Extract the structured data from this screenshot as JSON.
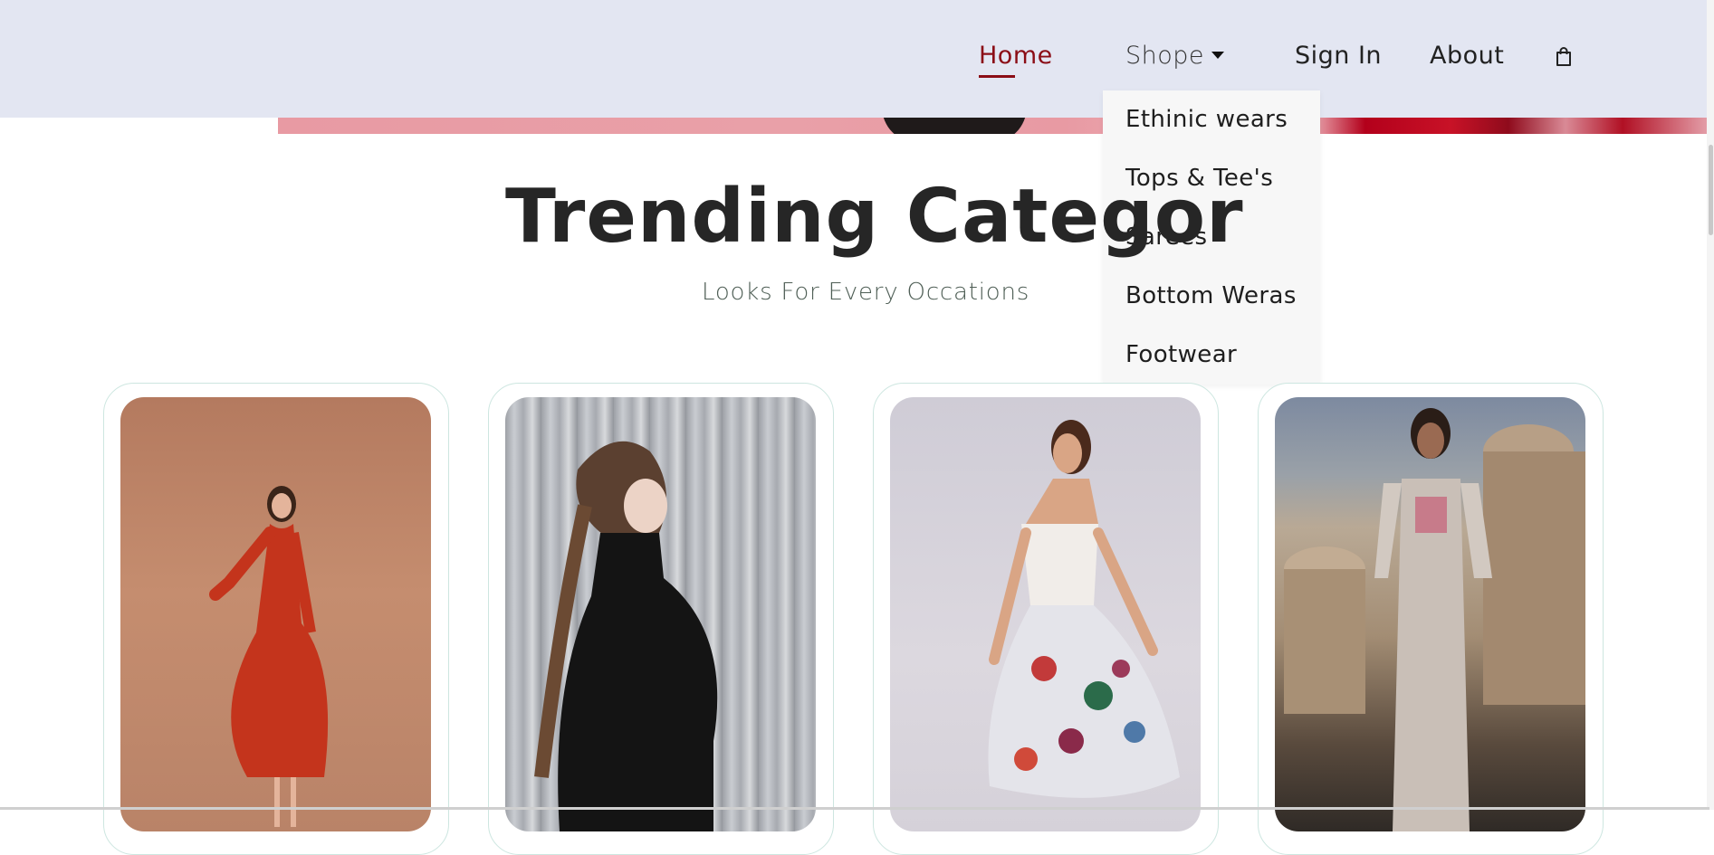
{
  "navbar": {
    "home_label": "Home",
    "shope_label": "Shope",
    "signin_label": "Sign In",
    "about_label": "About"
  },
  "dropdown": {
    "items": [
      "Ethinic wears",
      "Tops & Tee's",
      "Sarees",
      "Bottom Weras",
      "Footwear"
    ]
  },
  "section": {
    "title": "Trending Categor",
    "subtitle": "Looks For Every Occations"
  },
  "icons": {
    "bag": "shopping-bag-icon",
    "caret": "caret-down-icon"
  },
  "colors": {
    "active_nav": "#8b0d16",
    "navbar_bg": "#e3e6f2",
    "card_border": "#cde6e0"
  }
}
